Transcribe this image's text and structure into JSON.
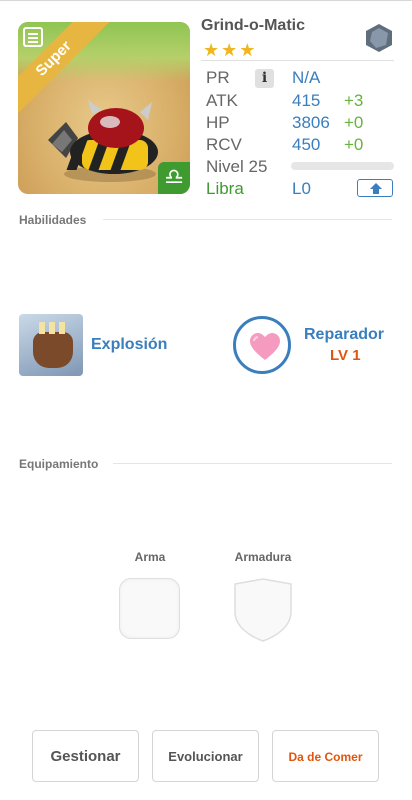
{
  "monster": {
    "name": "Grind-o-Matic",
    "stars": "★★★",
    "ribbon": "Super",
    "zodiac_symbol": "♎",
    "stats": [
      {
        "label": "PR",
        "value": "N/A",
        "plus": ""
      },
      {
        "label": "ATK",
        "value": "415",
        "plus": "+3"
      },
      {
        "label": "HP",
        "value": "3806",
        "plus": "+0"
      },
      {
        "label": "RCV",
        "value": "450",
        "plus": "+0"
      }
    ],
    "level_label": "Nivel 25",
    "zodiac_name": "Libra",
    "rank": "L0",
    "info_icon": "i"
  },
  "sections": {
    "skills": "Habilidades",
    "equipment": "Equipamiento"
  },
  "skill": {
    "name": "Explosión"
  },
  "leader": {
    "name": "Reparador",
    "level": "LV 1"
  },
  "equipment": {
    "weapon_label": "Arma",
    "armor_label": "Armadura"
  },
  "buttons": {
    "manage": "Gestionar",
    "evolve": "Evolucionar",
    "feed": "Da de Comer"
  },
  "colors": {
    "accent_blue": "#3a7ebd",
    "green": "#66b43b",
    "orange": "#e0560e",
    "star": "#f1b520"
  }
}
